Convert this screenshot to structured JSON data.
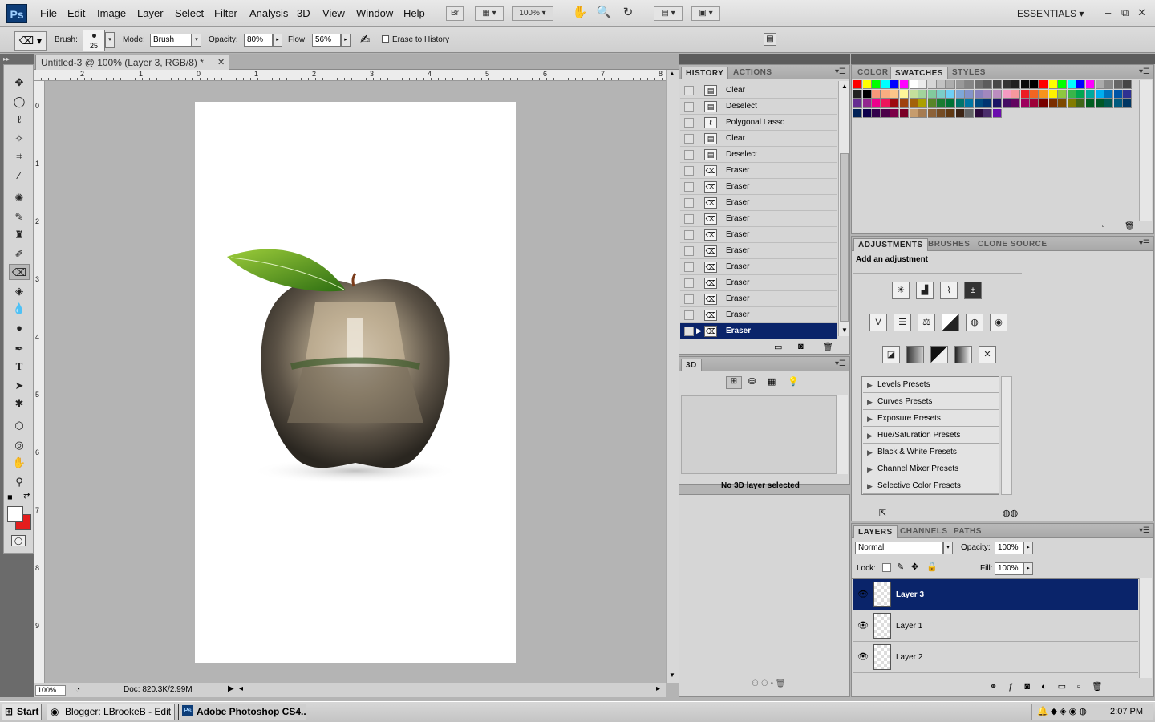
{
  "app": {
    "logo": "Ps"
  },
  "menu": [
    "File",
    "Edit",
    "Image",
    "Layer",
    "Select",
    "Filter",
    "Analysis",
    "3D",
    "View",
    "Window",
    "Help"
  ],
  "menubar": {
    "bridge": "Br",
    "zoom": "100%",
    "workspace": "ESSENTIALS"
  },
  "options": {
    "brush_label": "Brush:",
    "brush_size": "25",
    "mode_label": "Mode:",
    "mode_value": "Brush",
    "opacity_label": "Opacity:",
    "opacity_value": "80%",
    "flow_label": "Flow:",
    "flow_value": "56%",
    "erase_history": "Erase to History"
  },
  "document": {
    "tab_title": "Untitled-3 @ 100% (Layer 3, RGB/8) *",
    "ruler_top": [
      "2",
      "1",
      "0",
      "1",
      "2",
      "3",
      "4",
      "5",
      "6",
      "7",
      "8"
    ],
    "ruler_left": [
      "0",
      "1",
      "2",
      "3",
      "4",
      "5",
      "6",
      "7",
      "8",
      "9"
    ],
    "zoom": "100%",
    "doc_size": "Doc: 820.3K/2.99M"
  },
  "history": {
    "tabs": [
      "HISTORY",
      "ACTIONS"
    ],
    "items": [
      {
        "label": "Clear",
        "icon": "doc-icon"
      },
      {
        "label": "Deselect",
        "icon": "doc-icon"
      },
      {
        "label": "Polygonal Lasso",
        "icon": "lasso-icon"
      },
      {
        "label": "Clear",
        "icon": "doc-icon"
      },
      {
        "label": "Deselect",
        "icon": "doc-icon"
      },
      {
        "label": "Eraser",
        "icon": "eraser-icon"
      },
      {
        "label": "Eraser",
        "icon": "eraser-icon"
      },
      {
        "label": "Eraser",
        "icon": "eraser-icon"
      },
      {
        "label": "Eraser",
        "icon": "eraser-icon"
      },
      {
        "label": "Eraser",
        "icon": "eraser-icon"
      },
      {
        "label": "Eraser",
        "icon": "eraser-icon"
      },
      {
        "label": "Eraser",
        "icon": "eraser-icon"
      },
      {
        "label": "Eraser",
        "icon": "eraser-icon"
      },
      {
        "label": "Eraser",
        "icon": "eraser-icon"
      },
      {
        "label": "Eraser",
        "icon": "eraser-icon"
      },
      {
        "label": "Eraser",
        "icon": "eraser-icon",
        "selected": true
      }
    ]
  },
  "panel3d": {
    "tab": "3D",
    "status": "No 3D layer selected"
  },
  "swatches": {
    "tabs": [
      "COLOR",
      "SWATCHES",
      "STYLES"
    ],
    "colors": [
      "#ff0000",
      "#ffff00",
      "#00ff00",
      "#00ffff",
      "#0000ff",
      "#ff00ff",
      "#ffffff",
      "#ebebeb",
      "#d6d6d6",
      "#c2c2c2",
      "#adadad",
      "#999999",
      "#858585",
      "#707070",
      "#5c5c5c",
      "#474747",
      "#333333",
      "#1f1f1f",
      "#0a0a0a",
      "#000000",
      "#ff0000",
      "#ffff00",
      "#00ff00",
      "#00ffff",
      "#0000ff",
      "#ff00ff",
      "#aaaaaa",
      "#888888",
      "#666666",
      "#444444",
      "#222222",
      "#000000",
      "#f7977a",
      "#f9ad81",
      "#fdc68a",
      "#fff79a",
      "#c4df9b",
      "#a2d39c",
      "#82ca9d",
      "#7bcdc8",
      "#6ecff6",
      "#7ea7d8",
      "#8493ca",
      "#8882be",
      "#a187be",
      "#bc8dbf",
      "#f49ac2",
      "#f6989d",
      "#ed1c24",
      "#f26522",
      "#f7941d",
      "#fff200",
      "#8dc73f",
      "#39b54a",
      "#00a651",
      "#00a99d",
      "#00aeef",
      "#0072bc",
      "#0054a6",
      "#2e3192",
      "#662d91",
      "#92278f",
      "#ec008c",
      "#ed145b",
      "#9e0b0f",
      "#a0410d",
      "#a36209",
      "#aba000",
      "#598527",
      "#1a7b30",
      "#007236",
      "#00746b",
      "#0076a3",
      "#004b80",
      "#003471",
      "#1b1464",
      "#440e62",
      "#630460",
      "#9e005d",
      "#9e0039",
      "#790000",
      "#7b2e00",
      "#7d4900",
      "#827b00",
      "#406618",
      "#005e20",
      "#005826",
      "#005952",
      "#005b7f",
      "#003663",
      "#002157",
      "#0d004c",
      "#32004b",
      "#4b0049",
      "#7b0046",
      "#7a0026",
      "#c69c6d",
      "#a67c52",
      "#8c6239",
      "#754c24",
      "#603913",
      "#3c2415",
      "#636466",
      "#2b0a3d",
      "#4a2c6b",
      "#6a0dad"
    ]
  },
  "adjustments": {
    "tabs": [
      "ADJUSTMENTS",
      "BRUSHES",
      "CLONE SOURCE"
    ],
    "heading": "Add an adjustment",
    "presets": [
      "Levels Presets",
      "Curves Presets",
      "Exposure Presets",
      "Hue/Saturation Presets",
      "Black & White Presets",
      "Channel Mixer Presets",
      "Selective Color Presets"
    ]
  },
  "layers": {
    "tabs": [
      "LAYERS",
      "CHANNELS",
      "PATHS"
    ],
    "blend_mode": "Normal",
    "opacity_label": "Opacity:",
    "opacity_value": "100%",
    "lock_label": "Lock:",
    "fill_label": "Fill:",
    "fill_value": "100%",
    "items": [
      {
        "name": "Layer 3",
        "selected": true
      },
      {
        "name": "Layer 1"
      },
      {
        "name": "Layer 2"
      }
    ]
  },
  "taskbar": {
    "start": "Start",
    "tasks": [
      {
        "label": "Blogger: LBrookeB - Edit ..."
      },
      {
        "label": "Adobe Photoshop CS4...",
        "active": true
      }
    ],
    "clock": "2:07 PM"
  }
}
